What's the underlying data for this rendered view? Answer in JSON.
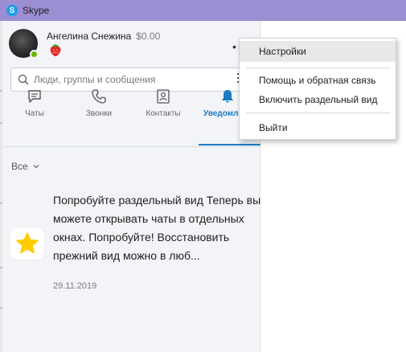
{
  "app": {
    "title": "Skype"
  },
  "profile": {
    "name": "Ангелина Снежина",
    "balance": "$0.00",
    "mood_icon": "strawberry-icon"
  },
  "search": {
    "placeholder": "Люди, группы и сообщения"
  },
  "tabs": [
    {
      "label": "Чаты",
      "icon": "chat-icon"
    },
    {
      "label": "Звонки",
      "icon": "phone-icon"
    },
    {
      "label": "Контакты",
      "icon": "contacts-icon"
    },
    {
      "label": "Уведомле",
      "icon": "bell-icon",
      "active": true
    }
  ],
  "filter": {
    "label": "Все"
  },
  "notification": {
    "text": "Попробуйте раздельный вид Теперь вы можете открывать чаты в отдельных окнах. Попробуйте! Восстановить прежний вид можно в люб...",
    "date": "29.11.2019",
    "icon": "star-icon"
  },
  "menu": {
    "items": [
      {
        "label": "Настройки",
        "highlighted": true
      },
      {
        "label": "Помощь и обратная связь"
      },
      {
        "label": "Включить раздельный вид"
      },
      {
        "label": "Выйти"
      }
    ]
  },
  "colors": {
    "titlebar": "#9b8ed2",
    "accent": "#1a7bc1",
    "online": "#6bb700",
    "star": "#ffcc00"
  }
}
